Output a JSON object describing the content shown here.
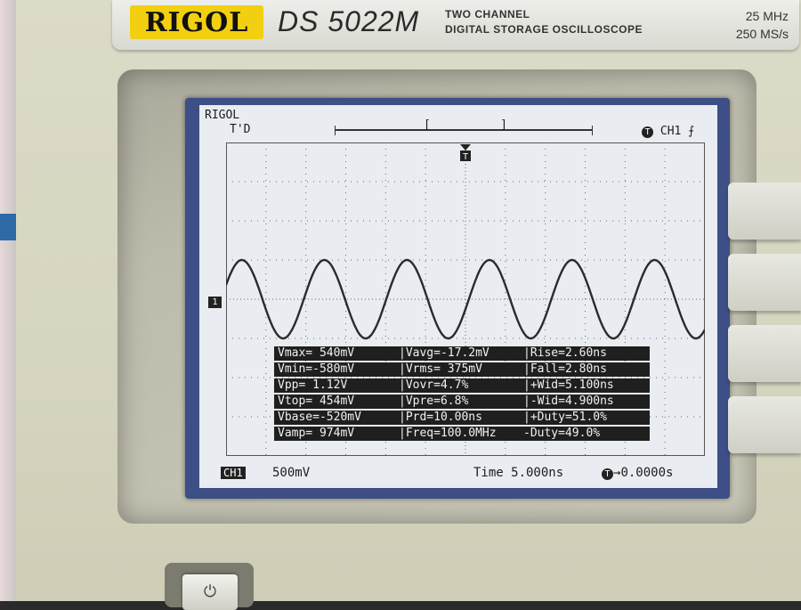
{
  "device": {
    "brand": "RIGOL",
    "model": "DS 5022M",
    "description_line1": "TWO CHANNEL",
    "description_line2": "DIGITAL STORAGE OSCILLOSCOPE",
    "bandwidth": "25 MHz",
    "sample_rate": "250 MS/s"
  },
  "screen": {
    "brand": "RIGOL",
    "status": "T'D",
    "trigger_source": "CH1",
    "trigger_edge_icon": "rising-edge-icon",
    "trigger_icon_text": "T",
    "channel_marker": "1",
    "measurements": [
      [
        "Vmax= 540mV",
        "|Vavg=-17.2mV",
        "|Rise=2.60ns"
      ],
      [
        "Vmin=-580mV",
        "|Vrms= 375mV",
        "|Fall=2.80ns"
      ],
      [
        "Vpp= 1.12V",
        "|Vovr=4.7%",
        "|+Wid=5.100ns"
      ],
      [
        "Vtop= 454mV",
        "|Vpre=6.8%",
        "|-Wid=4.900ns"
      ],
      [
        "Vbase=-520mV",
        "|Prd=10.00ns",
        "|+Duty=51.0%"
      ],
      [
        "Vamp= 974mV",
        "|Freq=100.0MHz",
        "-Duty=49.0%"
      ]
    ],
    "channel_tag": "CH1",
    "volts_per_div": "500mV",
    "time_base": "Time 5.000ns",
    "trigger_position": "0.0000s"
  },
  "colors": {
    "screen_bg": "#e9edf1",
    "trace": "#2b2b2b",
    "bezel_blue": "#3d4f86",
    "logo_yellow": "#f2cf10"
  },
  "waveform": {
    "cycles_visible": 5.8,
    "amplitude_divisions": 1.0,
    "offset_divisions": 0.0
  }
}
